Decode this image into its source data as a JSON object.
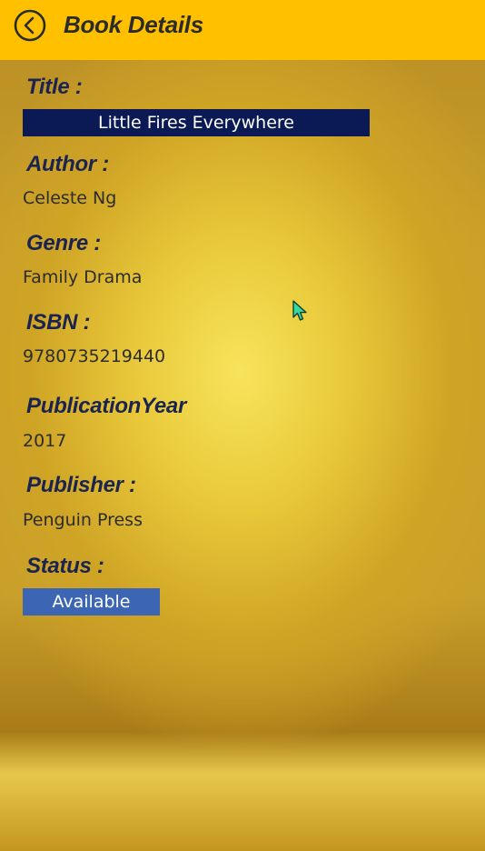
{
  "header": {
    "title": "Book Details",
    "back_icon": "chevron-left-circle-icon"
  },
  "book": {
    "title_label": "Title :",
    "title_value": "Little Fires Everywhere",
    "author_label": "Author :",
    "author_value": "Celeste Ng",
    "genre_label": "Genre :",
    "genre_value": "Family Drama",
    "isbn_label": "ISBN :",
    "isbn_value": "9780735219440",
    "year_label": "PublicationYear",
    "year_value": "2017",
    "publisher_label": "Publisher :",
    "publisher_value": "Penguin Press",
    "status_label": "Status :",
    "status_value": "Available"
  },
  "colors": {
    "header_bg": "#ffc000",
    "title_field_bg": "#0b1a55",
    "status_badge_bg": "#3c66b4",
    "label_text": "#1b2450"
  }
}
